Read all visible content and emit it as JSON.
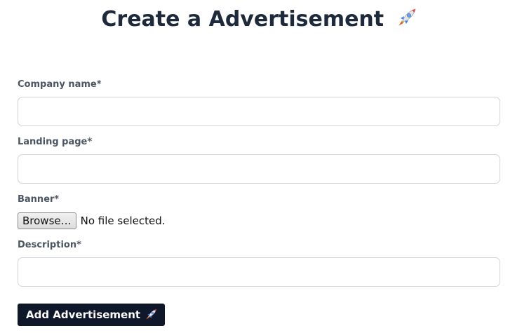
{
  "header": {
    "title": "Create a Advertisement",
    "title_icon": "rocket-icon"
  },
  "form": {
    "company_name": {
      "label": "Company name*",
      "value": "",
      "placeholder": ""
    },
    "landing_page": {
      "label": "Landing page*",
      "value": "",
      "placeholder": ""
    },
    "banner": {
      "label": "Banner*",
      "browse_label": "Browse…",
      "status": "No file selected."
    },
    "description": {
      "label": "Description*",
      "value": "",
      "placeholder": ""
    },
    "submit": {
      "label": "Add Advertisement",
      "icon": "rocket-icon"
    }
  },
  "colors": {
    "title": "#1e293b",
    "label": "#4b5563",
    "input_border": "#d1d5db",
    "button_bg": "#0f172a",
    "button_text": "#ffffff"
  }
}
